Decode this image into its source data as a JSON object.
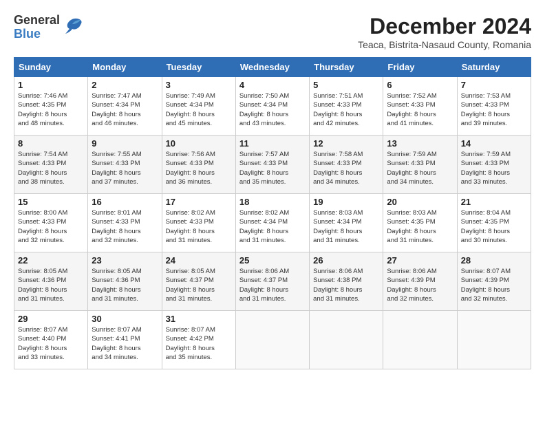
{
  "header": {
    "logo_general": "General",
    "logo_blue": "Blue",
    "month_title": "December 2024",
    "location": "Teaca, Bistrita-Nasaud County, Romania"
  },
  "weekdays": [
    "Sunday",
    "Monday",
    "Tuesday",
    "Wednesday",
    "Thursday",
    "Friday",
    "Saturday"
  ],
  "weeks": [
    [
      {
        "day": "1",
        "info": "Sunrise: 7:46 AM\nSunset: 4:35 PM\nDaylight: 8 hours\nand 48 minutes."
      },
      {
        "day": "2",
        "info": "Sunrise: 7:47 AM\nSunset: 4:34 PM\nDaylight: 8 hours\nand 46 minutes."
      },
      {
        "day": "3",
        "info": "Sunrise: 7:49 AM\nSunset: 4:34 PM\nDaylight: 8 hours\nand 45 minutes."
      },
      {
        "day": "4",
        "info": "Sunrise: 7:50 AM\nSunset: 4:34 PM\nDaylight: 8 hours\nand 43 minutes."
      },
      {
        "day": "5",
        "info": "Sunrise: 7:51 AM\nSunset: 4:33 PM\nDaylight: 8 hours\nand 42 minutes."
      },
      {
        "day": "6",
        "info": "Sunrise: 7:52 AM\nSunset: 4:33 PM\nDaylight: 8 hours\nand 41 minutes."
      },
      {
        "day": "7",
        "info": "Sunrise: 7:53 AM\nSunset: 4:33 PM\nDaylight: 8 hours\nand 39 minutes."
      }
    ],
    [
      {
        "day": "8",
        "info": "Sunrise: 7:54 AM\nSunset: 4:33 PM\nDaylight: 8 hours\nand 38 minutes."
      },
      {
        "day": "9",
        "info": "Sunrise: 7:55 AM\nSunset: 4:33 PM\nDaylight: 8 hours\nand 37 minutes."
      },
      {
        "day": "10",
        "info": "Sunrise: 7:56 AM\nSunset: 4:33 PM\nDaylight: 8 hours\nand 36 minutes."
      },
      {
        "day": "11",
        "info": "Sunrise: 7:57 AM\nSunset: 4:33 PM\nDaylight: 8 hours\nand 35 minutes."
      },
      {
        "day": "12",
        "info": "Sunrise: 7:58 AM\nSunset: 4:33 PM\nDaylight: 8 hours\nand 34 minutes."
      },
      {
        "day": "13",
        "info": "Sunrise: 7:59 AM\nSunset: 4:33 PM\nDaylight: 8 hours\nand 34 minutes."
      },
      {
        "day": "14",
        "info": "Sunrise: 7:59 AM\nSunset: 4:33 PM\nDaylight: 8 hours\nand 33 minutes."
      }
    ],
    [
      {
        "day": "15",
        "info": "Sunrise: 8:00 AM\nSunset: 4:33 PM\nDaylight: 8 hours\nand 32 minutes."
      },
      {
        "day": "16",
        "info": "Sunrise: 8:01 AM\nSunset: 4:33 PM\nDaylight: 8 hours\nand 32 minutes."
      },
      {
        "day": "17",
        "info": "Sunrise: 8:02 AM\nSunset: 4:33 PM\nDaylight: 8 hours\nand 31 minutes."
      },
      {
        "day": "18",
        "info": "Sunrise: 8:02 AM\nSunset: 4:34 PM\nDaylight: 8 hours\nand 31 minutes."
      },
      {
        "day": "19",
        "info": "Sunrise: 8:03 AM\nSunset: 4:34 PM\nDaylight: 8 hours\nand 31 minutes."
      },
      {
        "day": "20",
        "info": "Sunrise: 8:03 AM\nSunset: 4:35 PM\nDaylight: 8 hours\nand 31 minutes."
      },
      {
        "day": "21",
        "info": "Sunrise: 8:04 AM\nSunset: 4:35 PM\nDaylight: 8 hours\nand 30 minutes."
      }
    ],
    [
      {
        "day": "22",
        "info": "Sunrise: 8:05 AM\nSunset: 4:36 PM\nDaylight: 8 hours\nand 31 minutes."
      },
      {
        "day": "23",
        "info": "Sunrise: 8:05 AM\nSunset: 4:36 PM\nDaylight: 8 hours\nand 31 minutes."
      },
      {
        "day": "24",
        "info": "Sunrise: 8:05 AM\nSunset: 4:37 PM\nDaylight: 8 hours\nand 31 minutes."
      },
      {
        "day": "25",
        "info": "Sunrise: 8:06 AM\nSunset: 4:37 PM\nDaylight: 8 hours\nand 31 minutes."
      },
      {
        "day": "26",
        "info": "Sunrise: 8:06 AM\nSunset: 4:38 PM\nDaylight: 8 hours\nand 31 minutes."
      },
      {
        "day": "27",
        "info": "Sunrise: 8:06 AM\nSunset: 4:39 PM\nDaylight: 8 hours\nand 32 minutes."
      },
      {
        "day": "28",
        "info": "Sunrise: 8:07 AM\nSunset: 4:39 PM\nDaylight: 8 hours\nand 32 minutes."
      }
    ],
    [
      {
        "day": "29",
        "info": "Sunrise: 8:07 AM\nSunset: 4:40 PM\nDaylight: 8 hours\nand 33 minutes."
      },
      {
        "day": "30",
        "info": "Sunrise: 8:07 AM\nSunset: 4:41 PM\nDaylight: 8 hours\nand 34 minutes."
      },
      {
        "day": "31",
        "info": "Sunrise: 8:07 AM\nSunset: 4:42 PM\nDaylight: 8 hours\nand 35 minutes."
      },
      null,
      null,
      null,
      null
    ]
  ]
}
